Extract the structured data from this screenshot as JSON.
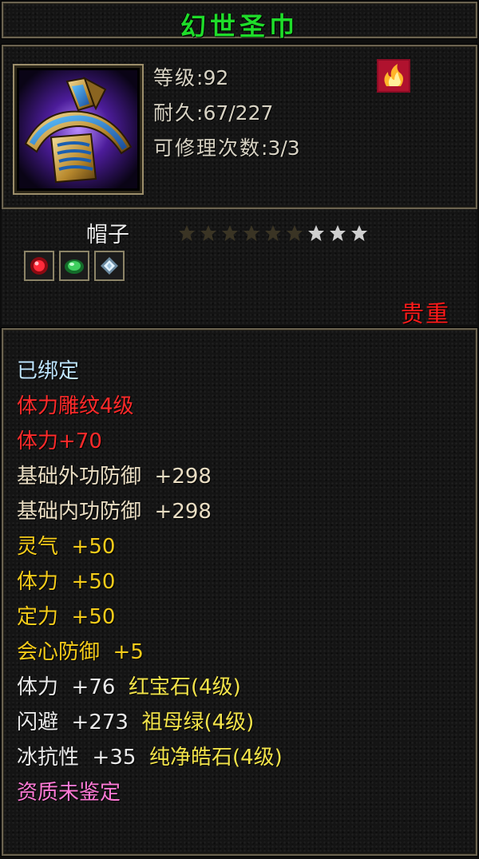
{
  "item": {
    "name": "幻世圣巾",
    "level_label": "等级",
    "level_value": ":92",
    "durability_label": "耐久",
    "durability_value": ":67/227",
    "repair_label": "可修理次数",
    "repair_value": ":3/3",
    "type": "帽子",
    "rarity": "贵重",
    "stars": {
      "total": 9,
      "filled_dim": 6,
      "lit": 3
    }
  },
  "icons": {
    "item_icon": "headband-icon",
    "badge": "flame-badge-icon",
    "gem_slots": [
      "ruby-gem-icon",
      "emerald-gem-icon",
      "diamond-gem-icon"
    ]
  },
  "colors": {
    "title": "#1fdc2a",
    "rarity": "#ff1a1a",
    "bound": "#bfe6ff",
    "engraving": "#ff2a2a",
    "base_defense": "#e9ddc3",
    "bonus": "#f5cc1a",
    "gem_name": "#f2e34a",
    "unidentified": "#ff7ad6"
  },
  "properties": {
    "bound": "已绑定",
    "engraving": "体力雕纹4级",
    "engraving_bonus": "体力+70",
    "base_lines": [
      {
        "label": "基础外功防御",
        "value": "+298"
      },
      {
        "label": "基础内功防御",
        "value": "+298"
      }
    ],
    "bonus_lines": [
      {
        "label": "灵气",
        "value": "+50"
      },
      {
        "label": "体力",
        "value": "+50"
      },
      {
        "label": "定力",
        "value": "+50"
      },
      {
        "label": "会心防御",
        "value": "+5"
      }
    ],
    "gem_lines": [
      {
        "label": "体力",
        "value": "+76",
        "gem": "红宝石(4级)"
      },
      {
        "label": "闪避",
        "value": "+273",
        "gem": "祖母绿(4级)"
      },
      {
        "label": "冰抗性",
        "value": "+35",
        "gem": "纯净皓石(4级)"
      }
    ],
    "quality": "资质未鉴定"
  }
}
